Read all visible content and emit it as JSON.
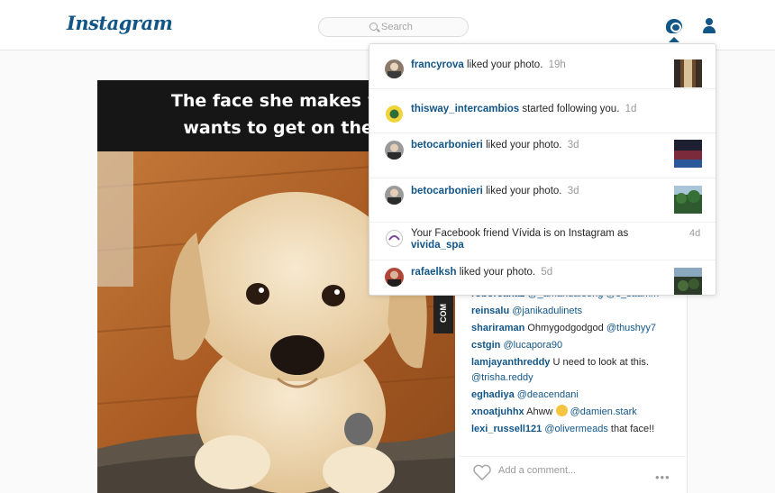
{
  "header": {
    "logo": "Instagram",
    "search_placeholder": "Search"
  },
  "post": {
    "image_caption": "The face she makes when s\nwants to get on the couc",
    "watermark": "COM",
    "comments": [
      {
        "user": "roboreanaz",
        "text": "@_amandaleong @s_saamm"
      },
      {
        "user": "reinsalu",
        "text": "@janikadulinets"
      },
      {
        "user": "shariraman",
        "text": "Ohmygodgodgod",
        "mention": "@thushyy7"
      },
      {
        "user": "cstgin",
        "text": "@lucapora90"
      },
      {
        "user": "lamjayanthreddy",
        "text": "U need to look at this.",
        "mention": "@trisha.reddy"
      },
      {
        "user": "eghadiya",
        "text": "@deacendani"
      },
      {
        "user": "xnoatjuhhx",
        "text": "Ahww",
        "mention": "@damien.stark"
      },
      {
        "user": "lexi_russell121",
        "text": "@olivermeads",
        "suffix": "that face!!"
      }
    ],
    "add_comment_placeholder": "Add a comment...",
    "more_label": "•••"
  },
  "notifications": [
    {
      "user": "francyrova",
      "text": "liked your photo.",
      "time": "19h",
      "avatar": "avatar-francyrova",
      "thumb": "street"
    },
    {
      "user": "thisway_intercambios",
      "text": "started following you.",
      "time": "1d",
      "avatar": "avatar-thisway"
    },
    {
      "user": "betocarbonieri",
      "text": "liked your photo.",
      "time": "3d",
      "avatar": "avatar-beto",
      "thumb": "stage"
    },
    {
      "user": "betocarbonieri",
      "text": "liked your photo.",
      "time": "3d",
      "avatar": "avatar-beto",
      "thumb": "trees"
    },
    {
      "prefix": "Your Facebook friend Vívida is on Instagram as",
      "user": "vivida_spa",
      "time": "4d",
      "avatar": "avatar-vivida"
    },
    {
      "user": "rafaelksh",
      "text": "liked your photo.",
      "time": "5d",
      "avatar": "avatar-rafael",
      "thumb": "crowd"
    }
  ],
  "colors": {
    "brand": "#125688",
    "muted": "#999999",
    "border": "#dbdbdb"
  },
  "icons": [
    "search-icon",
    "activity-icon",
    "profile-icon",
    "heart-icon",
    "more-options-icon"
  ]
}
